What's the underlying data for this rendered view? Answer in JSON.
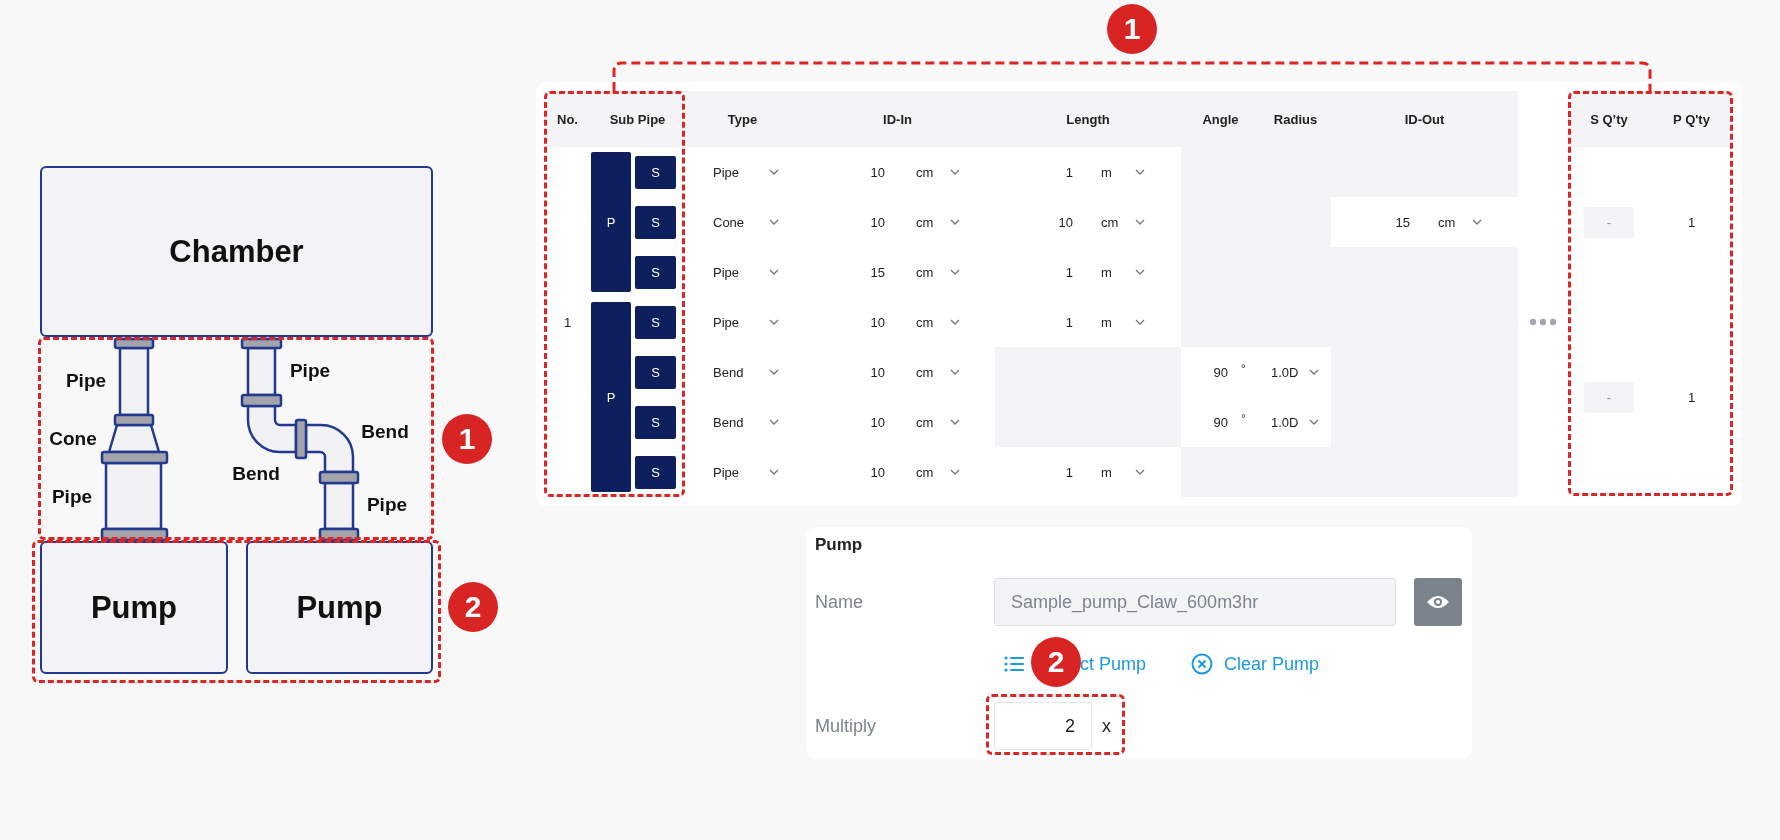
{
  "diagram": {
    "chamber": "Chamber",
    "labels": [
      "Pipe",
      "Cone",
      "Pipe",
      "Pipe",
      "Bend",
      "Bend",
      "Pipe"
    ],
    "pumps": [
      "Pump",
      "Pump"
    ]
  },
  "table": {
    "columns": [
      "No.",
      "Sub Pipe",
      "Type",
      "ID-In",
      "Length",
      "Angle",
      "Radius",
      "ID-Out",
      "S Q’ty",
      "P Q'ty"
    ],
    "no": "1",
    "groups": [
      {
        "p": "P",
        "s_qty": "-",
        "p_qty": "1",
        "rows": [
          {
            "sub": "S",
            "type": "Pipe",
            "id_in": {
              "value": "10",
              "unit": "cm"
            },
            "length": {
              "value": "1",
              "unit": "m"
            }
          },
          {
            "sub": "S",
            "type": "Cone",
            "id_in": {
              "value": "10",
              "unit": "cm"
            },
            "length": {
              "value": "10",
              "unit": "cm"
            },
            "id_out": {
              "value": "15",
              "unit": "cm"
            }
          },
          {
            "sub": "S",
            "type": "Pipe",
            "id_in": {
              "value": "15",
              "unit": "cm"
            },
            "length": {
              "value": "1",
              "unit": "m"
            }
          }
        ]
      },
      {
        "p": "P",
        "s_qty": "-",
        "p_qty": "1",
        "rows": [
          {
            "sub": "S",
            "type": "Pipe",
            "id_in": {
              "value": "10",
              "unit": "cm"
            },
            "length": {
              "value": "1",
              "unit": "m"
            }
          },
          {
            "sub": "S",
            "type": "Bend",
            "id_in": {
              "value": "10",
              "unit": "cm"
            },
            "angle": {
              "value": "90",
              "unit": "°"
            },
            "radius": "1.0D"
          },
          {
            "sub": "S",
            "type": "Bend",
            "id_in": {
              "value": "10",
              "unit": "cm"
            },
            "angle": {
              "value": "90",
              "unit": "°"
            },
            "radius": "1.0D"
          },
          {
            "sub": "S",
            "type": "Pipe",
            "id_in": {
              "value": "10",
              "unit": "cm"
            },
            "length": {
              "value": "1",
              "unit": "m"
            }
          }
        ]
      }
    ]
  },
  "pump": {
    "title": "Pump",
    "name_label": "Name",
    "name_value": "Sample_pump_Claw_600m3hr",
    "name_disabled": true,
    "select": "ct Pump",
    "clear": "Clear Pump",
    "multiply_label": "Multiply",
    "multiply_value": "2",
    "multiply_suffix": "x"
  },
  "badges": [
    {
      "label": "1"
    },
    {
      "label": "2"
    },
    {
      "label": "1"
    },
    {
      "label": "2"
    }
  ]
}
